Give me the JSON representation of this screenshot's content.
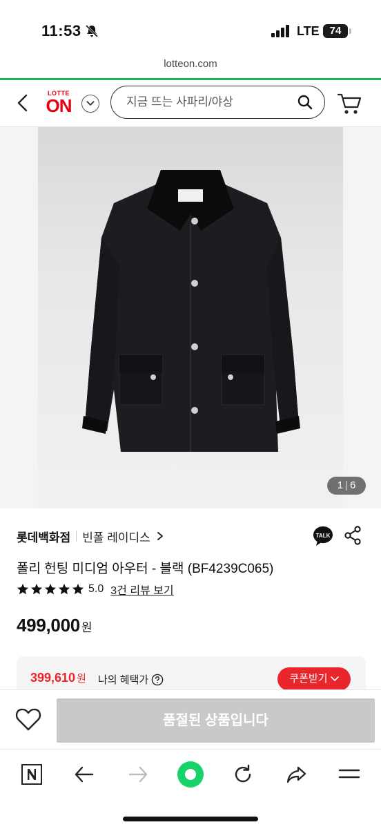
{
  "status_bar": {
    "time": "11:53",
    "network": "LTE",
    "battery": "74"
  },
  "url": "lotteon.com",
  "header": {
    "logo_top": "LOTTE",
    "logo_main": "ON",
    "search_placeholder": "지금 뜨는 사파리/야상"
  },
  "gallery": {
    "current": "1",
    "total": "6"
  },
  "product": {
    "store": "롯데백화점",
    "brand": "빈폴 레이디스",
    "title": "폴리 헌팅 미디엄 아우터 - 블랙 (BF4239C065)",
    "rating": "5.0",
    "rating_stars": 5,
    "reviews_link": "3건 리뷰 보기",
    "price": "499,000",
    "price_unit": "원"
  },
  "benefit": {
    "discount_price": "399,610",
    "discount_unit": "원",
    "my_benefit_label": "나의 혜택가",
    "coupon_button": "쿠폰받기"
  },
  "action": {
    "soldout_label": "품절된 상품입니다"
  },
  "talk_label": "TALK",
  "colors": {
    "brand_red": "#e60012",
    "accent_green": "#1fb25a",
    "discount_red": "#e8262b",
    "home_green": "#16d36a"
  }
}
